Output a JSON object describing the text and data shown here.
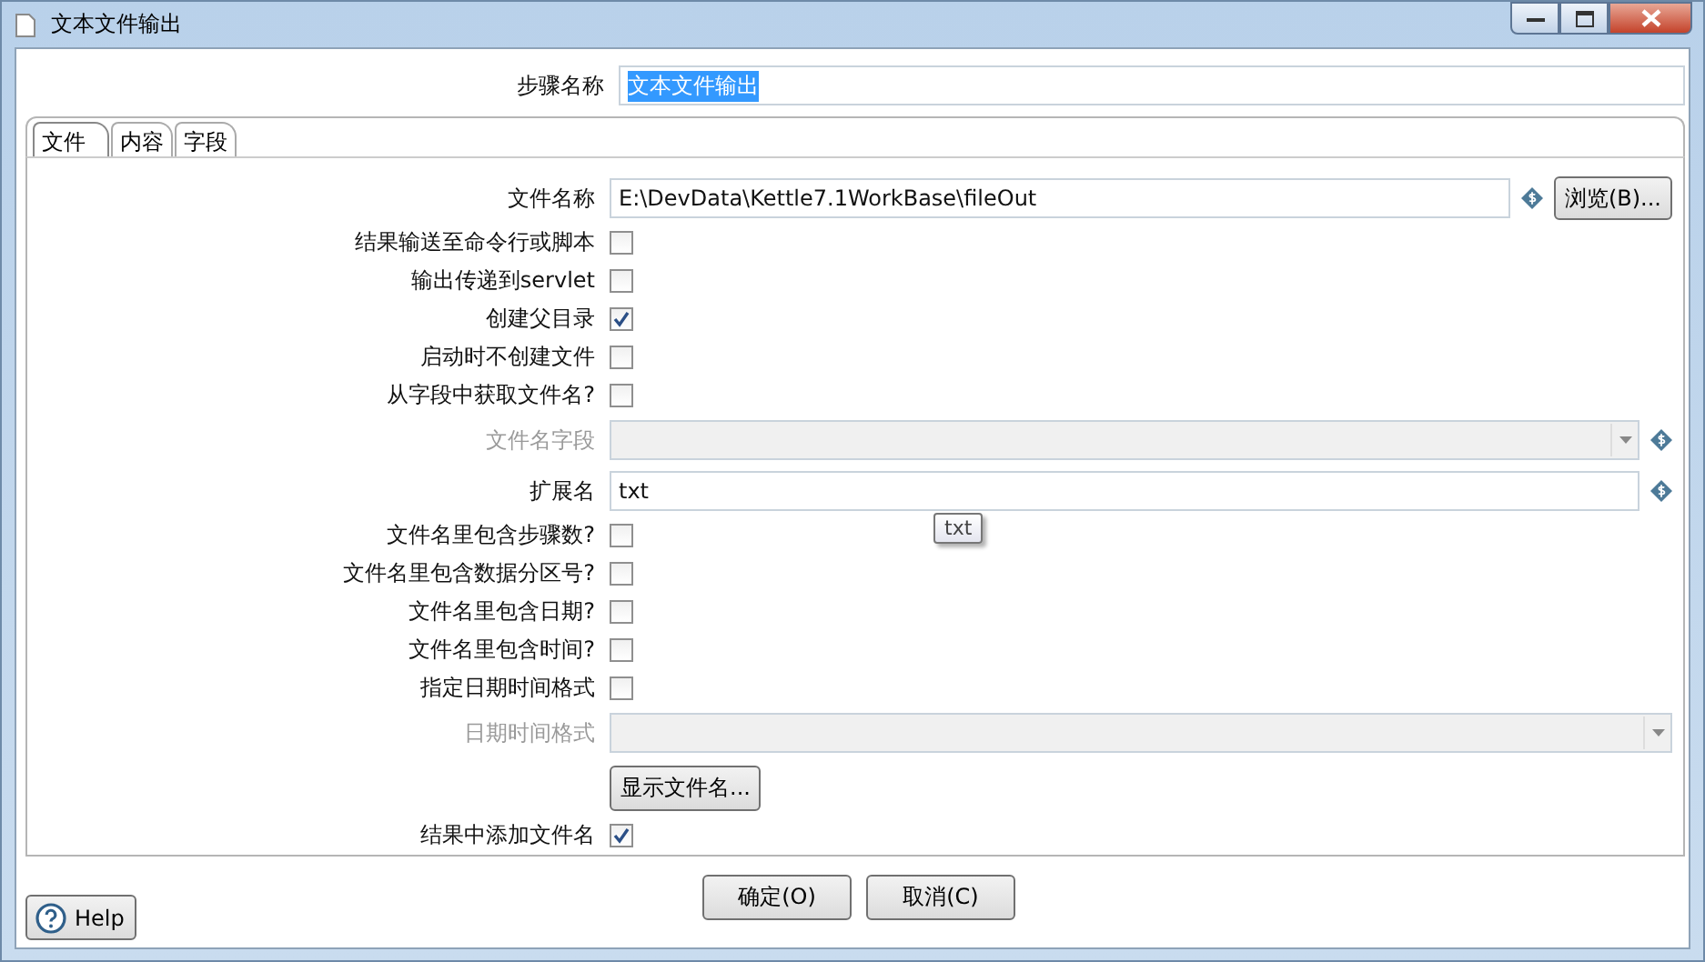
{
  "window": {
    "title": "文本文件输出"
  },
  "step_name": {
    "label": "步骤名称",
    "value": "文本文件输出"
  },
  "tabs": [
    {
      "label": "文件",
      "selected": true
    },
    {
      "label": "内容",
      "selected": false
    },
    {
      "label": "字段",
      "selected": false
    }
  ],
  "rows": [
    {
      "kind": "text",
      "label": "文件名称",
      "value": "E:\\DevData\\Kettle7.1WorkBase\\fileOut",
      "variable": true,
      "button": "浏览(B)..."
    },
    {
      "kind": "check",
      "label": "结果输送至命令行或脚本",
      "checked": false
    },
    {
      "kind": "check",
      "label": "输出传递到servlet",
      "checked": false
    },
    {
      "kind": "check",
      "label": "创建父目录",
      "checked": true
    },
    {
      "kind": "check",
      "label": "启动时不创建文件",
      "checked": false
    },
    {
      "kind": "check",
      "label": "从字段中获取文件名?",
      "checked": false
    },
    {
      "kind": "combo",
      "label": "文件名字段",
      "disabled": true,
      "variable": true
    },
    {
      "kind": "text",
      "label": "扩展名",
      "value": "txt",
      "variable": true,
      "tooltip": "txt"
    },
    {
      "kind": "check",
      "label": "文件名里包含步骤数?",
      "checked": false
    },
    {
      "kind": "check",
      "label": "文件名里包含数据分区号?",
      "checked": false
    },
    {
      "kind": "check",
      "label": "文件名里包含日期?",
      "checked": false
    },
    {
      "kind": "check",
      "label": "文件名里包含时间?",
      "checked": false
    },
    {
      "kind": "check",
      "label": "指定日期时间格式",
      "checked": false
    },
    {
      "kind": "combo",
      "label": "日期时间格式",
      "disabled": true,
      "variable": false
    },
    {
      "kind": "button",
      "label": "显示文件名..."
    },
    {
      "kind": "check",
      "label": "结果中添加文件名",
      "checked": true
    }
  ],
  "buttons": [
    "确定(O)",
    "取消(C)"
  ],
  "help": "Help"
}
